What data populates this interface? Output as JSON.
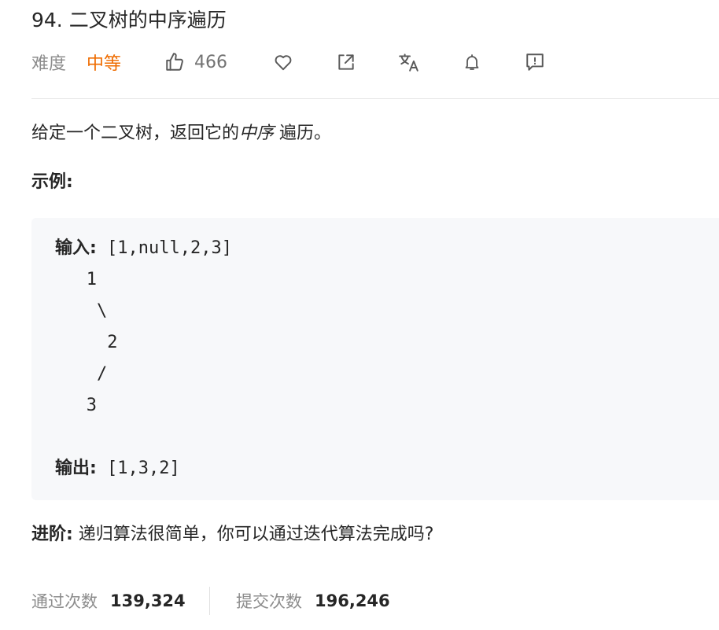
{
  "problem": {
    "title": "94. 二叉树的中序遍历",
    "difficulty_label": "难度",
    "difficulty_value": "中等",
    "likes": "466"
  },
  "colors": {
    "difficulty": "#ef6c00",
    "text": "#262626",
    "muted": "#8c8c8c",
    "code_bg": "#f7f8fa"
  },
  "icons": [
    "thumbs-up-icon",
    "heart-icon",
    "share-icon",
    "translate-icon",
    "bell-icon",
    "feedback-icon"
  ],
  "description": {
    "before": "给定一个二叉树，返回它的",
    "emphasis": "中序",
    "after": " 遍历。"
  },
  "example": {
    "heading": "示例:",
    "input_label": "输入:",
    "input_value": " [1,null,2,3]",
    "tree_lines": [
      "   1",
      "    \\",
      "     2",
      "    /",
      "   3"
    ],
    "output_label": "输出:",
    "output_value": " [1,3,2]"
  },
  "advance": {
    "label": "进阶:",
    "text": " 递归算法很简单，你可以通过迭代算法完成吗?"
  },
  "stats": {
    "accepted_label": "通过次数",
    "accepted_value": "139,324",
    "submissions_label": "提交次数",
    "submissions_value": "196,246"
  }
}
